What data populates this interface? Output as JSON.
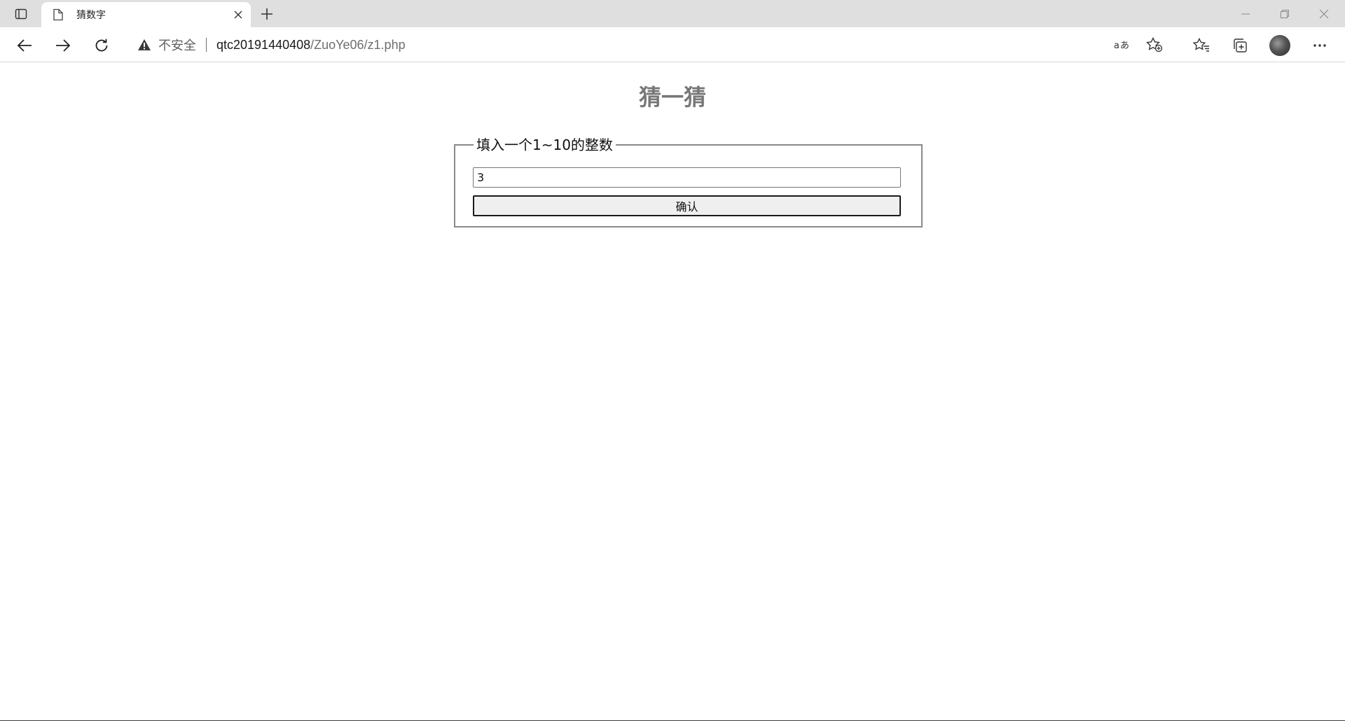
{
  "browser": {
    "tab": {
      "title": "猜数字"
    },
    "address_bar": {
      "security_label": "不安全",
      "url_host": "qtc20191440408",
      "url_path": "/ZuoYe06/z1.php"
    },
    "icons": {
      "tab_actions": "tab-actions-icon",
      "page": "page-icon",
      "close": "close-icon",
      "new_tab": "plus-icon",
      "back": "arrow-left-icon",
      "forward": "arrow-right-icon",
      "reload": "reload-icon",
      "warning": "warning-triangle-icon",
      "read_aloud": "read-aloud-icon",
      "add_favorite": "star-add-icon",
      "favorites": "favorites-icon",
      "collections": "collections-icon",
      "more": "more-icon",
      "minimize": "minimize-icon",
      "maximize": "restore-icon",
      "window_close": "close-icon"
    }
  },
  "page": {
    "title": "猜一猜",
    "form": {
      "legend": "填入一个1~10的整数",
      "input_value": "3",
      "submit_label": "确认"
    }
  }
}
